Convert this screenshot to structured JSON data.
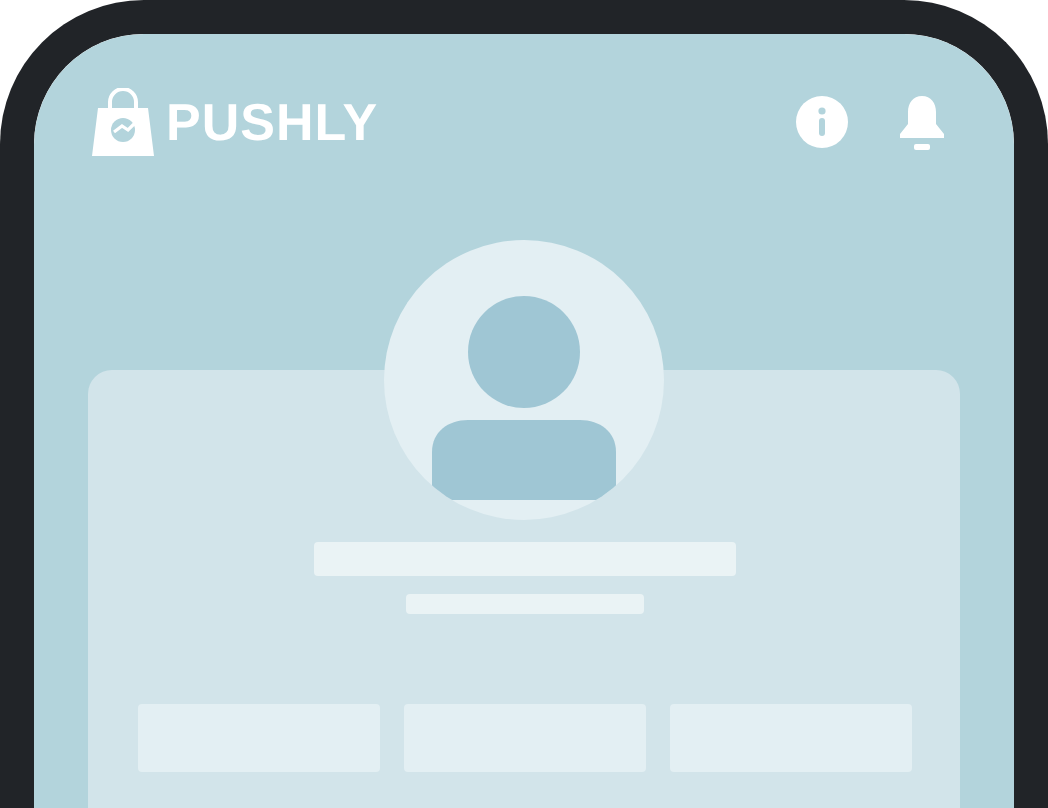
{
  "app": {
    "brand": "PUSHLY"
  }
}
